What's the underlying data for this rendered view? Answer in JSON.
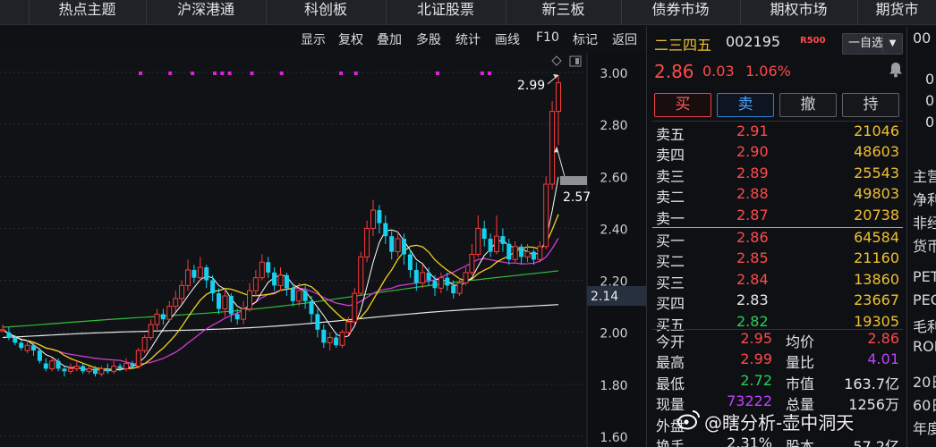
{
  "nav": {
    "tabs": [
      "热点主题",
      "沪深港通",
      "科创板",
      "北证股票",
      "新三板",
      "债券市场",
      "期权市场",
      "期货市"
    ]
  },
  "toolbar": {
    "buttons": [
      "显示",
      "复权",
      "叠加",
      "多股",
      "统计",
      "画线",
      "F10",
      "标记",
      "返回"
    ]
  },
  "chart_data": {
    "type": "candlestick",
    "ylim": [
      1.6,
      3.02
    ],
    "ytick_labels": [
      "3.00",
      "2.80",
      "2.60",
      "2.40",
      "2.20",
      "2.00",
      "1.80",
      "1.60"
    ],
    "ytick_values": [
      3.0,
      2.8,
      2.6,
      2.4,
      2.2,
      2.0,
      1.8,
      1.6
    ],
    "high_label": "2.99",
    "low_label": "2.57",
    "current_price_label": "2.14",
    "up_color": "#ff3b3b",
    "down_color": "#18d0ee",
    "candles": [
      [
        2.01,
        2.01,
        2.03,
        2.0
      ],
      [
        2.0,
        1.98,
        2.02,
        1.97
      ],
      [
        1.98,
        1.96,
        1.99,
        1.95
      ],
      [
        1.96,
        1.94,
        1.97,
        1.93
      ],
      [
        1.93,
        1.95,
        1.97,
        1.92
      ],
      [
        1.95,
        1.93,
        1.96,
        1.91
      ],
      [
        1.93,
        1.89,
        1.94,
        1.88
      ],
      [
        1.88,
        1.86,
        1.9,
        1.85
      ],
      [
        1.86,
        1.89,
        1.9,
        1.85
      ],
      [
        1.89,
        1.86,
        1.9,
        1.85
      ],
      [
        1.86,
        1.85,
        1.87,
        1.83
      ],
      [
        1.85,
        1.86,
        1.88,
        1.84
      ],
      [
        1.86,
        1.87,
        1.89,
        1.85
      ],
      [
        1.87,
        1.85,
        1.88,
        1.84
      ],
      [
        1.85,
        1.86,
        1.87,
        1.84
      ],
      [
        1.86,
        1.84,
        1.87,
        1.83
      ],
      [
        1.84,
        1.86,
        1.87,
        1.83
      ],
      [
        1.86,
        1.85,
        1.88,
        1.84
      ],
      [
        1.85,
        1.87,
        1.89,
        1.84
      ],
      [
        1.87,
        1.86,
        1.88,
        1.85
      ],
      [
        1.86,
        1.88,
        1.9,
        1.85
      ],
      [
        1.88,
        1.87,
        1.89,
        1.86
      ],
      [
        1.87,
        1.93,
        1.94,
        1.86
      ],
      [
        1.93,
        1.98,
        1.99,
        1.92
      ],
      [
        1.98,
        2.03,
        2.05,
        1.97
      ],
      [
        2.03,
        2.07,
        2.09,
        2.01
      ],
      [
        2.07,
        2.05,
        2.09,
        2.03
      ],
      [
        2.05,
        2.1,
        2.12,
        2.04
      ],
      [
        2.1,
        2.13,
        2.16,
        2.08
      ],
      [
        2.13,
        2.18,
        2.2,
        2.11
      ],
      [
        2.18,
        2.24,
        2.28,
        2.16
      ],
      [
        2.24,
        2.21,
        2.26,
        2.19
      ],
      [
        2.21,
        2.25,
        2.29,
        2.2
      ],
      [
        2.25,
        2.2,
        2.26,
        2.17
      ],
      [
        2.2,
        2.15,
        2.22,
        2.12
      ],
      [
        2.15,
        2.09,
        2.17,
        2.07
      ],
      [
        2.09,
        2.14,
        2.17,
        2.06
      ],
      [
        2.14,
        2.07,
        2.15,
        2.04
      ],
      [
        2.07,
        2.05,
        2.09,
        2.03
      ],
      [
        2.05,
        2.09,
        2.12,
        2.03
      ],
      [
        2.09,
        2.16,
        2.19,
        2.08
      ],
      [
        2.16,
        2.21,
        2.24,
        2.14
      ],
      [
        2.21,
        2.27,
        2.3,
        2.2
      ],
      [
        2.27,
        2.23,
        2.29,
        2.21
      ],
      [
        2.23,
        2.18,
        2.25,
        2.16
      ],
      [
        2.18,
        2.22,
        2.25,
        2.16
      ],
      [
        2.22,
        2.17,
        2.23,
        2.14
      ],
      [
        2.17,
        2.12,
        2.19,
        2.1
      ],
      [
        2.12,
        2.16,
        2.19,
        2.1
      ],
      [
        2.16,
        2.12,
        2.18,
        2.09
      ],
      [
        2.12,
        2.07,
        2.14,
        2.03
      ],
      [
        2.07,
        2.01,
        2.09,
        1.98
      ],
      [
        2.01,
        1.96,
        2.03,
        1.94
      ],
      [
        1.96,
        1.98,
        2.0,
        1.93
      ],
      [
        1.98,
        1.95,
        2.0,
        1.94
      ],
      [
        1.95,
        2.0,
        2.01,
        1.94
      ],
      [
        2.0,
        2.04,
        2.06,
        1.99
      ],
      [
        2.04,
        2.15,
        2.17,
        2.03
      ],
      [
        2.15,
        2.29,
        2.31,
        2.14
      ],
      [
        2.29,
        2.4,
        2.43,
        2.27
      ],
      [
        2.4,
        2.47,
        2.51,
        2.37
      ],
      [
        2.47,
        2.42,
        2.49,
        2.38
      ],
      [
        2.42,
        2.37,
        2.45,
        2.34
      ],
      [
        2.37,
        2.31,
        2.39,
        2.28
      ],
      [
        2.31,
        2.36,
        2.39,
        2.29
      ],
      [
        2.36,
        2.3,
        2.38,
        2.26
      ],
      [
        2.3,
        2.24,
        2.32,
        2.21
      ],
      [
        2.24,
        2.19,
        2.27,
        2.16
      ],
      [
        2.19,
        2.23,
        2.26,
        2.17
      ],
      [
        2.23,
        2.2,
        2.25,
        2.18
      ],
      [
        2.2,
        2.17,
        2.22,
        2.14
      ],
      [
        2.17,
        2.21,
        2.23,
        2.15
      ],
      [
        2.21,
        2.18,
        2.23,
        2.16
      ],
      [
        2.18,
        2.15,
        2.2,
        2.13
      ],
      [
        2.15,
        2.19,
        2.21,
        2.14
      ],
      [
        2.19,
        2.23,
        2.25,
        2.18
      ],
      [
        2.23,
        2.3,
        2.34,
        2.22
      ],
      [
        2.3,
        2.4,
        2.45,
        2.29
      ],
      [
        2.4,
        2.36,
        2.43,
        2.33
      ],
      [
        2.36,
        2.31,
        2.38,
        2.29
      ],
      [
        2.31,
        2.37,
        2.45,
        2.3
      ],
      [
        2.37,
        2.34,
        2.4,
        2.31
      ],
      [
        2.34,
        2.28,
        2.36,
        2.26
      ],
      [
        2.28,
        2.33,
        2.35,
        2.27
      ],
      [
        2.33,
        2.29,
        2.34,
        2.26
      ],
      [
        2.29,
        2.31,
        2.34,
        2.27
      ],
      [
        2.31,
        2.28,
        2.32,
        2.26
      ],
      [
        2.28,
        2.33,
        2.35,
        2.27
      ],
      [
        2.33,
        2.57,
        2.6,
        2.32
      ],
      [
        2.57,
        2.85,
        2.89,
        2.55
      ],
      [
        2.85,
        2.96,
        2.99,
        2.72
      ]
    ],
    "markers": [
      0,
      4,
      7,
      10,
      11,
      12,
      15,
      19,
      27,
      29,
      40,
      46,
      47
    ]
  },
  "quote": {
    "name": "二三四五",
    "code": "002195",
    "tag": "R500",
    "watch_label": "一自选",
    "watch_dropdown": "▼",
    "price": "2.86",
    "change": "0.03",
    "pct": "1.06%",
    "buttons": {
      "buy": "买",
      "sell": "卖",
      "cancel": "撤",
      "hold": "持"
    },
    "asks": [
      {
        "label": "卖五",
        "price": "2.91",
        "vol": "21046",
        "color": "#ff4a4a"
      },
      {
        "label": "卖四",
        "price": "2.90",
        "vol": "48603",
        "color": "#ff4a4a"
      },
      {
        "label": "卖三",
        "price": "2.89",
        "vol": "25543",
        "color": "#ff4a4a"
      },
      {
        "label": "卖二",
        "price": "2.88",
        "vol": "49803",
        "color": "#ff4a4a"
      },
      {
        "label": "卖一",
        "price": "2.87",
        "vol": "20738",
        "color": "#ff4a4a"
      }
    ],
    "bids": [
      {
        "label": "买一",
        "price": "2.86",
        "vol": "64584",
        "color": "#ff4a4a"
      },
      {
        "label": "买二",
        "price": "2.85",
        "vol": "21160",
        "color": "#ff4a4a"
      },
      {
        "label": "买三",
        "price": "2.84",
        "vol": "13860",
        "color": "#ff4a4a"
      },
      {
        "label": "买四",
        "price": "2.83",
        "vol": "23667",
        "color": "#e6e6e6"
      },
      {
        "label": "买五",
        "price": "2.82",
        "vol": "19305",
        "color": "#26d05a"
      }
    ],
    "stats": [
      {
        "l1": "今开",
        "v1": "2.95",
        "c1": "#ff4a4a",
        "l2": "均价",
        "v2": "2.86",
        "c2": "#ff4a4a"
      },
      {
        "l1": "最高",
        "v1": "2.99",
        "c1": "#ff4a4a",
        "l2": "量比",
        "v2": "4.01",
        "c2": "#c040ff"
      },
      {
        "l1": "最低",
        "v1": "2.72",
        "c1": "#26d05a",
        "l2": "市值",
        "v2": "163.7亿",
        "c2": "#e6e6e6"
      },
      {
        "l1": "现量",
        "v1": "73222",
        "c1": "#c040ff",
        "l2": "总量",
        "v2": "1256万",
        "c2": "#e6e6e6"
      },
      {
        "l1": "外盘",
        "v1": "",
        "c1": "#ff4a4a",
        "l2": "",
        "v2": "",
        "c2": "#e6e6e6"
      },
      {
        "l1": "换手",
        "v1": "2.31%",
        "c1": "#e6e6e6",
        "l2": "股本",
        "v2": "57.2亿",
        "c2": "#e6e6e6"
      }
    ]
  },
  "side_panel": {
    "texts": [
      "00",
      "0",
      "0",
      "0",
      "主营",
      "净利",
      "非经",
      "货币",
      "PET",
      "PEG",
      "毛利",
      "ROE",
      "20日",
      "60日",
      "年度"
    ]
  },
  "watermark": "@瞎分析-壶中洞天"
}
